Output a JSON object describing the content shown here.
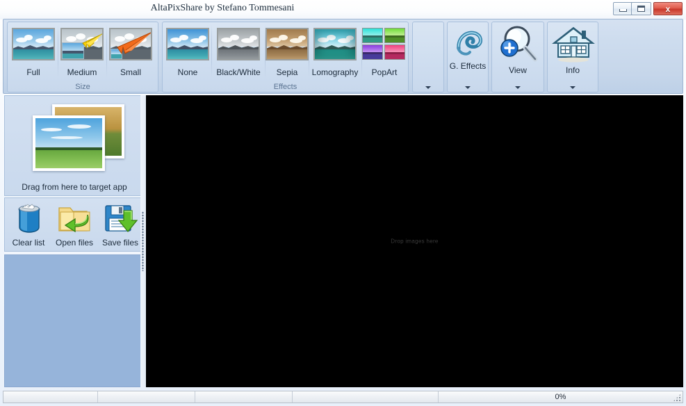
{
  "window": {
    "title": "AltaPixShare by Stefano Tommesani",
    "controls": {
      "minimize": "minimize-button",
      "maximize": "maximize-button",
      "close_glyph": "x"
    }
  },
  "ribbon": {
    "groups": [
      {
        "label": "Size",
        "items": [
          {
            "label": "Full",
            "icon": "landscape-full-thumbnail"
          },
          {
            "label": "Medium",
            "icon": "landscape-medium-thumbnail"
          },
          {
            "label": "Small",
            "icon": "landscape-small-thumbnail"
          }
        ]
      },
      {
        "label": "Effects",
        "items": [
          {
            "label": "None",
            "icon": "effect-none-thumbnail"
          },
          {
            "label": "Black/White",
            "icon": "effect-blackwhite-thumbnail"
          },
          {
            "label": "Sepia",
            "icon": "effect-sepia-thumbnail"
          },
          {
            "label": "Lomography",
            "icon": "effect-lomography-thumbnail"
          },
          {
            "label": "PopArt",
            "icon": "effect-popart-thumbnail"
          }
        ]
      }
    ],
    "buttons": [
      {
        "label": "",
        "icon": "empty-gallery",
        "has_dropdown": true
      },
      {
        "label": "G. Effects",
        "icon": "swirl-icon",
        "has_dropdown": true
      },
      {
        "label": "View",
        "icon": "magnifier-plus-icon",
        "has_dropdown": true
      },
      {
        "label": "Info",
        "icon": "house-icon",
        "has_dropdown": true
      }
    ]
  },
  "left_panel": {
    "drag_caption": "Drag from here to target app",
    "tools": [
      {
        "label": "Clear list",
        "icon": "trash-bin-icon"
      },
      {
        "label": "Open files",
        "icon": "open-folder-icon"
      },
      {
        "label": "Save files",
        "icon": "floppy-save-icon"
      }
    ]
  },
  "canvas": {
    "hint": "Drop images here",
    "background": "#000000"
  },
  "statusbar": {
    "panels": [
      "",
      "",
      "",
      "",
      "0%"
    ],
    "progress_percent": "0%"
  },
  "colors": {
    "ribbon_blue": "#cddcee",
    "group_border": "#a9c0dc",
    "group_label": "#5a7391",
    "list_blue": "#96b4da",
    "canvas_black": "#000000",
    "close_red": "#c8372a"
  }
}
